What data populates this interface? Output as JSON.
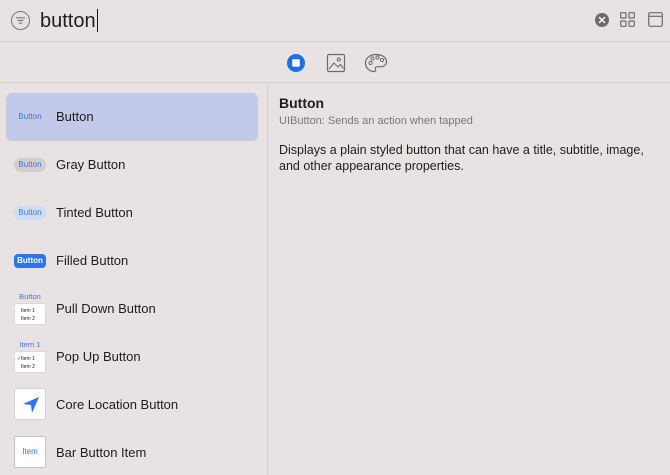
{
  "search": {
    "query": "button"
  },
  "sidebar": {
    "items": [
      {
        "label": "Button",
        "thumb_text": "Button",
        "selected": true
      },
      {
        "label": "Gray Button",
        "thumb_text": "Button"
      },
      {
        "label": "Tinted Button",
        "thumb_text": "Button"
      },
      {
        "label": "Filled Button",
        "thumb_text": "Button"
      },
      {
        "label": "Pull Down Button",
        "thumb_title": "Button",
        "menu": [
          "Item 1",
          "Item 2"
        ]
      },
      {
        "label": "Pop Up Button",
        "thumb_title": "Item 1",
        "menu": [
          "Item 1",
          "Item 2"
        ],
        "check": "✓"
      },
      {
        "label": "Core Location Button"
      },
      {
        "label": "Bar Button Item",
        "thumb_text": "Item"
      }
    ]
  },
  "detail": {
    "title": "Button",
    "subtitle": "UIButton: Sends an action when tapped",
    "description": "Displays a plain styled button that can have a title, subtitle, image, and other appearance properties."
  },
  "colors": {
    "background": "#e8e2e3",
    "selection": "#c2c9e9",
    "accent": "#2e74f0"
  },
  "icons": {
    "filter": "filter-circle-icon",
    "clear": "clear-circle-icon",
    "grid": "grid-icon",
    "window": "window-icon",
    "controls": "controls-icon",
    "image": "image-icon",
    "palette": "palette-icon",
    "location": "location-arrow-icon"
  }
}
